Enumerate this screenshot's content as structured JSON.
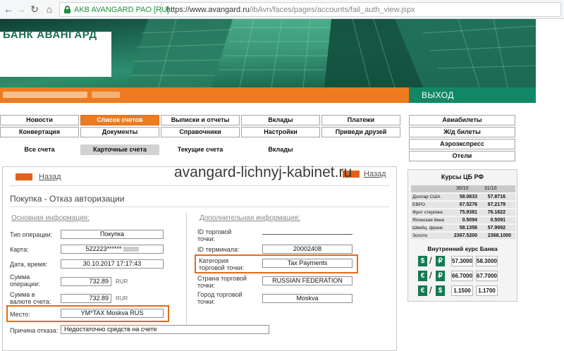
{
  "browser": {
    "secure_label": "AKB AVANGARD PAO [RU]",
    "url_domain": "https://www.avangard.ru",
    "url_path": "/ibAvn/faces/pages/accounts/fail_auth_view.jspx",
    "icons": [
      "back-arrow-icon",
      "forward-arrow-icon",
      "reload-icon",
      "home-icon",
      "lock-icon"
    ]
  },
  "header": {
    "logo": "БАНК АВАНГАРД",
    "logout": "ВЫХОД"
  },
  "menu_rows": [
    [
      "Новости",
      "Список счетов",
      "Выписки и отчеты",
      "Вклады",
      "Платежи"
    ],
    [
      "Конвертация",
      "Документы",
      "Справочники",
      "Настройки",
      "Приведи друзей"
    ]
  ],
  "active_menu": "Список счетов",
  "submenu": [
    "Все счета",
    "Карточные счета",
    "Текущие счета",
    "Вклады"
  ],
  "active_submenu": "Карточные счета",
  "right_menu": [
    "Авиабилеты",
    "Ж/д билеты",
    "Аэроэкспресс",
    "Отели"
  ],
  "panel": {
    "back_label": "Назад",
    "title": "Покупка - Отказ авторизации",
    "section_main": "Основная информация:",
    "section_extra": "Дополнительная информация:",
    "main_fields": {
      "op_type": {
        "label": "Тип операции:",
        "value": "Покупка"
      },
      "card": {
        "label": "Карта:",
        "value": "522223******"
      },
      "datetime": {
        "label": "Дата, время:",
        "value": "30.10.2017 17:17:43"
      },
      "amount": {
        "label": "Сумма операции:",
        "value": "732.89",
        "currency": "RUR"
      },
      "amount_acc": {
        "label": "Сумма в валюте счета:",
        "value": "732.89",
        "currency": "RUR"
      },
      "place": {
        "label": "Место:",
        "value": "YM*TAX Moskva RUS"
      }
    },
    "extra_fields": {
      "merchant_id": {
        "label": "ID торговой точки:",
        "value": ""
      },
      "terminal_id": {
        "label": "ID терминала:",
        "value": "20002408"
      },
      "category": {
        "label": "Категория торговой точки:",
        "value": "Tax Payments"
      },
      "country": {
        "label": "Страна торговой точки:",
        "value": "RUSSIAN FEDERATION"
      },
      "city": {
        "label": "Город торговой точки:",
        "value": "Moskva"
      }
    },
    "reason": {
      "label": "Причина отказа:",
      "value": "Недостаточно средств на счете"
    },
    "highlight_color": "#e36a17"
  },
  "watermark": "avangard-lichnyj-kabinet.ru",
  "rates": {
    "title": "Курсы ЦБ РФ",
    "col1": "30/10",
    "col2": "31/10",
    "rows": [
      {
        "name": "Доллар США",
        "v1": "58.0833",
        "v2": "57.8716"
      },
      {
        "name": "ЕВРО",
        "v1": "67.5276",
        "v2": "67.2179"
      },
      {
        "name": "Фунт стерлинг.",
        "v1": "75.9381",
        "v2": "76.1822"
      },
      {
        "name": "Японская йена",
        "v1": "0.5094",
        "v2": "0.5091"
      },
      {
        "name": "Швейц. франк",
        "v1": "58.1356",
        "v2": "57.9992"
      },
      {
        "name": "Золото",
        "v1": "2367.5200",
        "v2": "2368.1000"
      }
    ],
    "inner_title": "Внутренний курс Банка",
    "inner": [
      {
        "icon": "dollar-icon",
        "glyph": "$",
        "buy": "57.3000",
        "sell": "58.3000"
      },
      {
        "icon": "euro-icon",
        "glyph": "€",
        "buy": "66.7000",
        "sell": "67.7000"
      },
      {
        "icon": "euro-dollar-icon",
        "glyph": "€",
        "glyph2": "$",
        "buy": "1.1500",
        "sell": "1.1700"
      }
    ],
    "ruble_glyph": "₽"
  }
}
